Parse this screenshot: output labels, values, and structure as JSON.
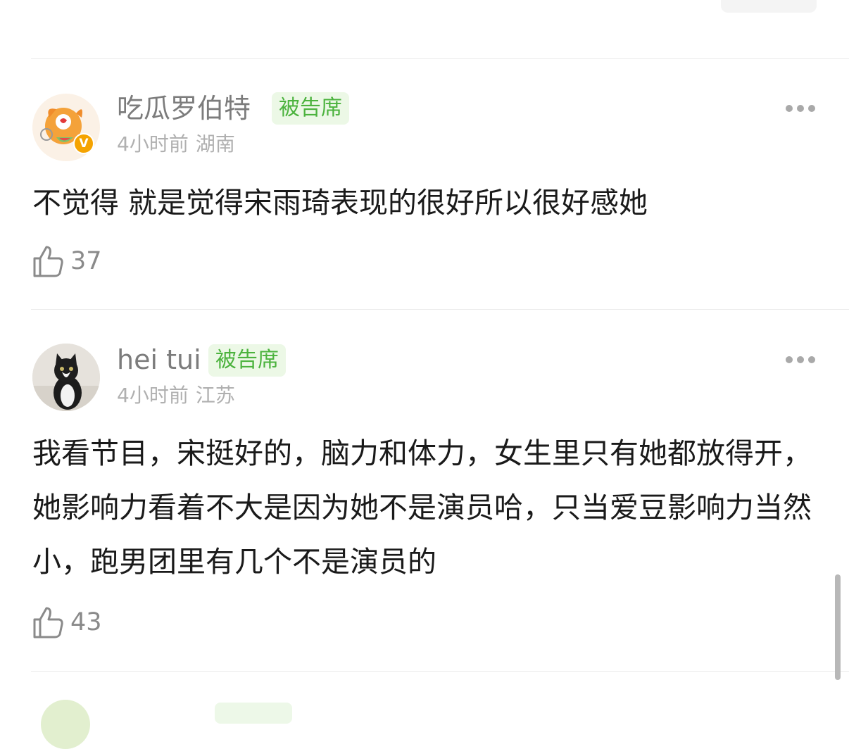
{
  "comments": [
    {
      "username": "吃瓜罗伯特",
      "badge": "被告席",
      "time": "4小时前",
      "location": "湖南",
      "text": "不觉得 就是觉得宋雨琦表现的很好所以很好感她",
      "likes": "37",
      "avatar_icon": "cartoon-mascot-avatar",
      "verified_mark": "V"
    },
    {
      "username": "hei tui",
      "badge": "被告席",
      "time": "4小时前",
      "location": "江苏",
      "text": "我看节目，宋挺好的，脑力和体力，女生里只有她都放得开，她影响力看着不大是因为她不是演员哈，只当爱豆影响力当然小，跑男团里有几个不是演员的",
      "likes": "43",
      "avatar_icon": "cat-photo-avatar"
    }
  ],
  "icons": {
    "like": "thumbs-up-icon",
    "more": "more-dots-icon"
  },
  "colors": {
    "badge_bg": "#ecf8e6",
    "badge_text": "#4cb33e",
    "username": "#7c7c7c",
    "meta": "#b0b0b0"
  }
}
